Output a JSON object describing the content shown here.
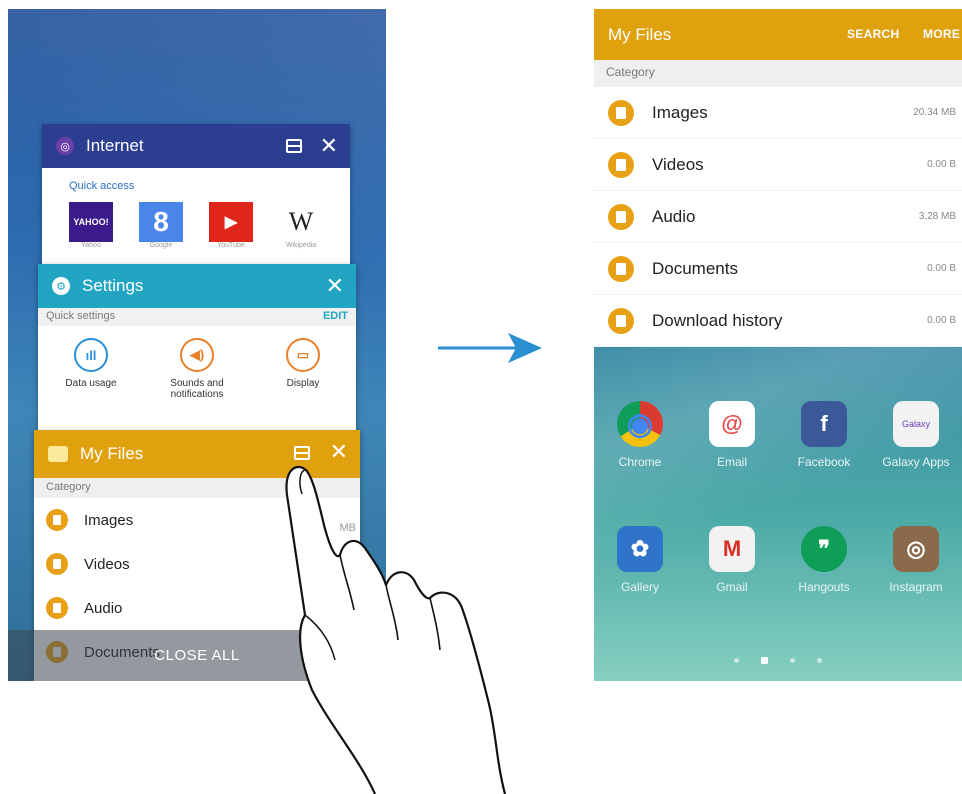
{
  "left": {
    "internet": {
      "title": "Internet",
      "subtitle": "Quick access",
      "tiles": [
        {
          "text": "YAHOO!",
          "label": "Yahoo",
          "color": "#3b1a8c"
        },
        {
          "text": "8",
          "label": "Google",
          "color": "#4a86e8"
        },
        {
          "text": "▶",
          "label": "YouTube",
          "color": "#e0261b"
        },
        {
          "text": "W",
          "label": "Wikipedia",
          "color": "#ffffff"
        }
      ]
    },
    "settings": {
      "title": "Settings",
      "subtitle": "Quick settings",
      "edit_label": "EDIT",
      "items": [
        {
          "label": "Data usage",
          "icon": "ıll",
          "color": "#2a8fd8"
        },
        {
          "label": "Sounds and notifications",
          "icon": "◀)",
          "color": "#e8812a"
        },
        {
          "label": "Display",
          "icon": "▭",
          "color": "#e8812a"
        }
      ]
    },
    "myfiles": {
      "title": "My Files",
      "category": "Category",
      "rows": [
        "Images",
        "Videos",
        "Audio",
        "Documents"
      ],
      "partial_size": "MB"
    },
    "close_all": "CLOSE ALL"
  },
  "right": {
    "title": "My Files",
    "search_label": "SEARCH",
    "more_label": "MORE",
    "category": "Category",
    "rows": [
      {
        "label": "Images",
        "size": "20.34 MB"
      },
      {
        "label": "Videos",
        "size": "0.00 B"
      },
      {
        "label": "Audio",
        "size": "3.28 MB"
      },
      {
        "label": "Documents",
        "size": "0.00 B"
      },
      {
        "label": "Download history",
        "size": "0.00 B"
      }
    ],
    "apps_row1": [
      {
        "label": "Chrome",
        "glyph": "◉",
        "color": "#db3a2f"
      },
      {
        "label": "Email",
        "glyph": "@",
        "color": "#e84a4a"
      },
      {
        "label": "Facebook",
        "glyph": "f",
        "color": "#3b5998"
      },
      {
        "label": "Galaxy Apps",
        "glyph": "Galaxy",
        "color": "#f2f2f2"
      }
    ],
    "apps_row2": [
      {
        "label": "Gallery",
        "glyph": "✿",
        "color": "#2f74c9"
      },
      {
        "label": "Gmail",
        "glyph": "M",
        "color": "#f2f2f2"
      },
      {
        "label": "Hangouts",
        "glyph": "❞",
        "color": "#0f9d58"
      },
      {
        "label": "Instagram",
        "glyph": "◎",
        "color": "#8a6a4a"
      }
    ],
    "page_dots": 4,
    "active_dot": 1
  },
  "colors": {
    "myfiles_bar": "#e0a10e",
    "internet_bar": "#2c3e8f",
    "settings_bar": "#22a5c2",
    "arrow": "#2a8fd0"
  }
}
